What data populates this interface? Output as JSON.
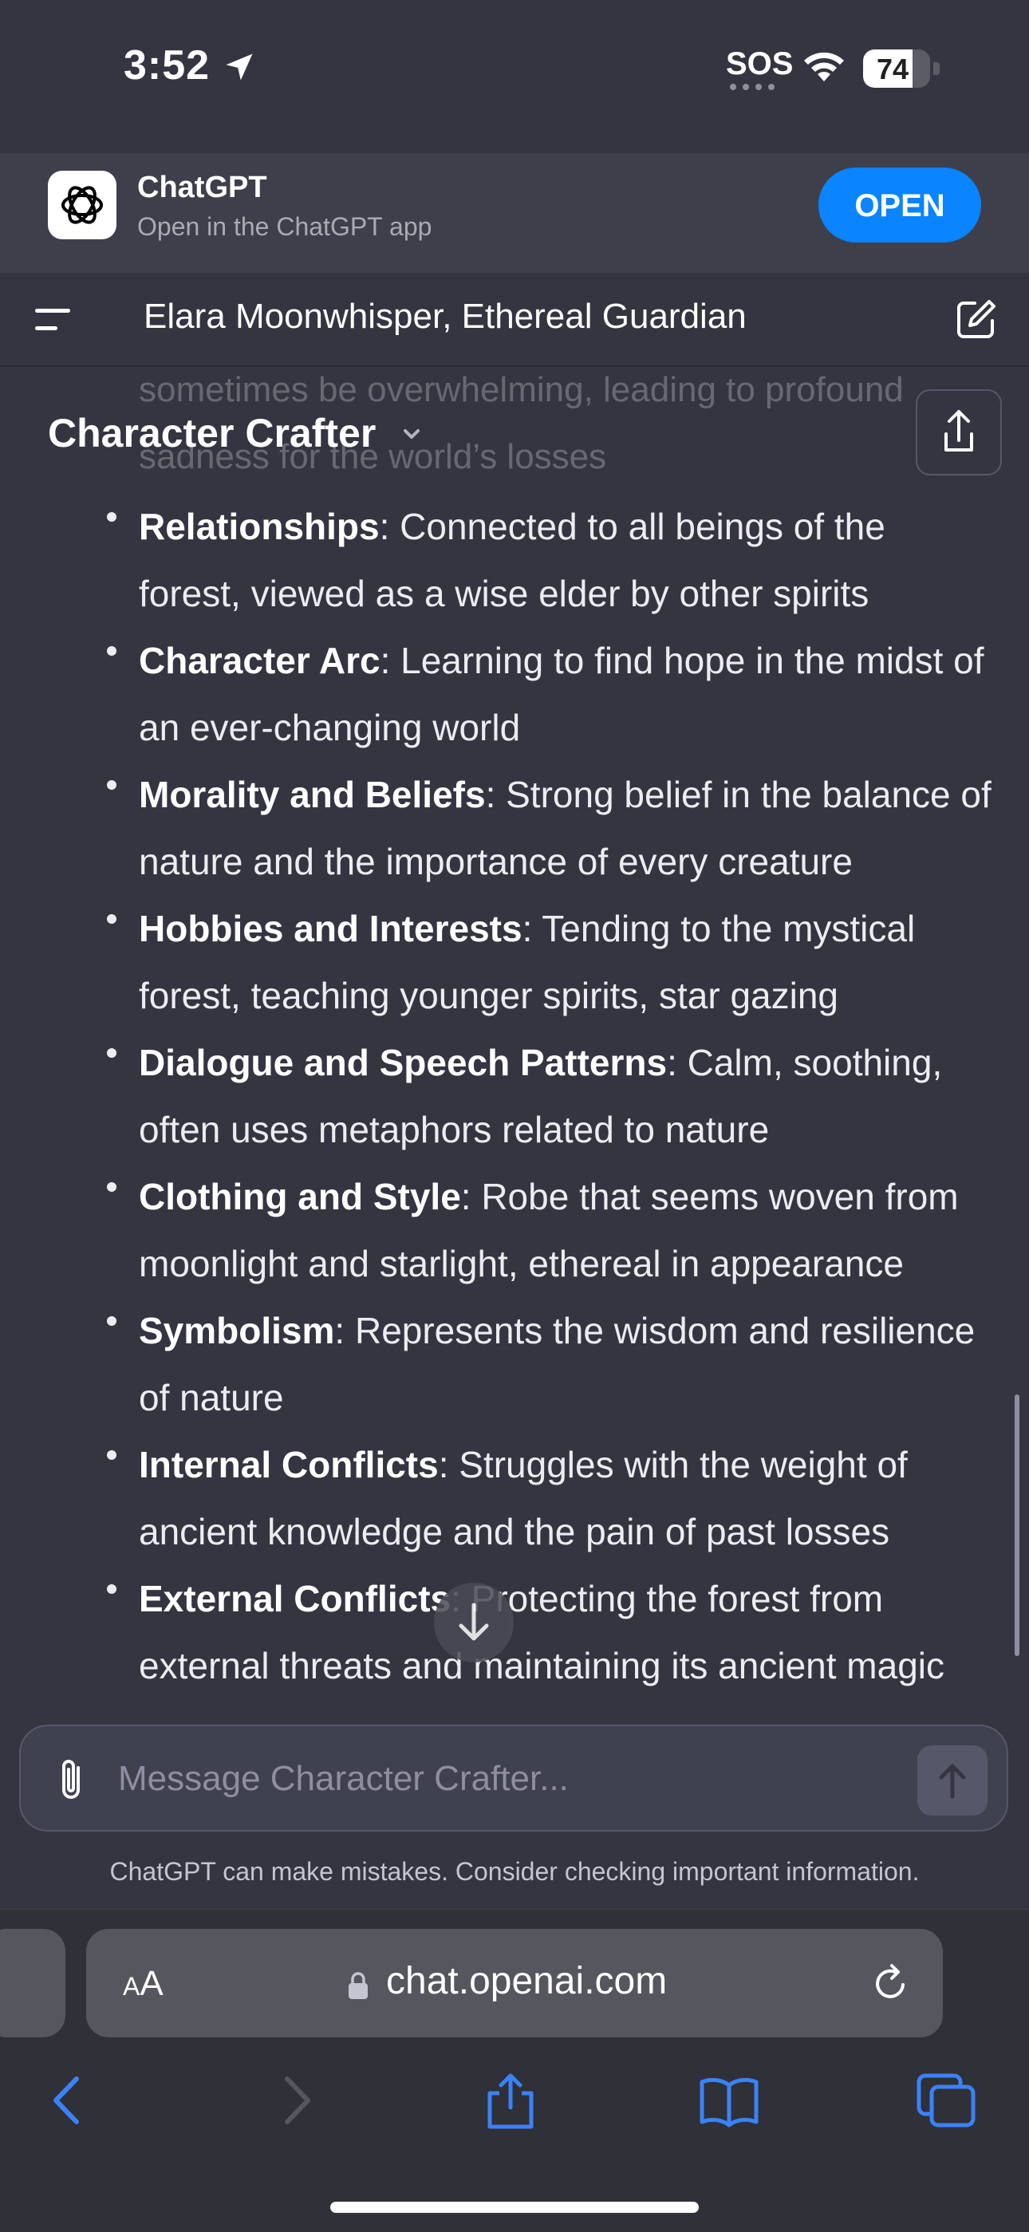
{
  "status_bar": {
    "time": "3:52",
    "sos": "SOS",
    "battery": "74",
    "battery_level": 0.74
  },
  "banner": {
    "app_name": "ChatGPT",
    "subtitle": "Open in the ChatGPT app",
    "open_label": "OPEN"
  },
  "header": {
    "title": "Elara Moonwhisper, Ethereal Guardian",
    "model": "Character Crafter"
  },
  "faded_lines": [
    "sometimes be overwhelming, leading to profound",
    "sadness for the world’s losses"
  ],
  "items": [
    {
      "label": "Relationships",
      "text": ": Connected to all beings of the forest, viewed as a wise elder by other spirits"
    },
    {
      "label": "Character Arc",
      "text": ": Learning to find hope in the midst of an ever-changing world"
    },
    {
      "label": "Morality and Beliefs",
      "text": ": Strong belief in the balance of nature and the importance of every creature"
    },
    {
      "label": "Hobbies and Interests",
      "text": ": Tending to the mystical forest, teaching younger spirits, star gazing"
    },
    {
      "label": "Dialogue and Speech Patterns",
      "text": ": Calm, soothing, often uses metaphors related to nature"
    },
    {
      "label": "Clothing and Style",
      "text": ": Robe that seems woven from moonlight and starlight, ethereal in appearance"
    },
    {
      "label": "Symbolism",
      "text": ": Represents the wisdom and resilience of nature"
    },
    {
      "label": "Internal Conflicts",
      "text": ": Struggles with the weight of ancient knowledge and the pain of past losses"
    },
    {
      "label": "External Conflicts",
      "text": ": Protecting the forest from external threats and maintaining its ancient magic"
    }
  ],
  "composer": {
    "placeholder": "Message Character Crafter..."
  },
  "disclaimer": "ChatGPT can make mistakes. Consider checking important information.",
  "safari": {
    "aa_small": "A",
    "aa_large": "A",
    "url": "chat.openai.com"
  },
  "colors": {
    "background": "#343541",
    "accent": "#0a84ff",
    "safari_blue": "#3b82f6"
  }
}
